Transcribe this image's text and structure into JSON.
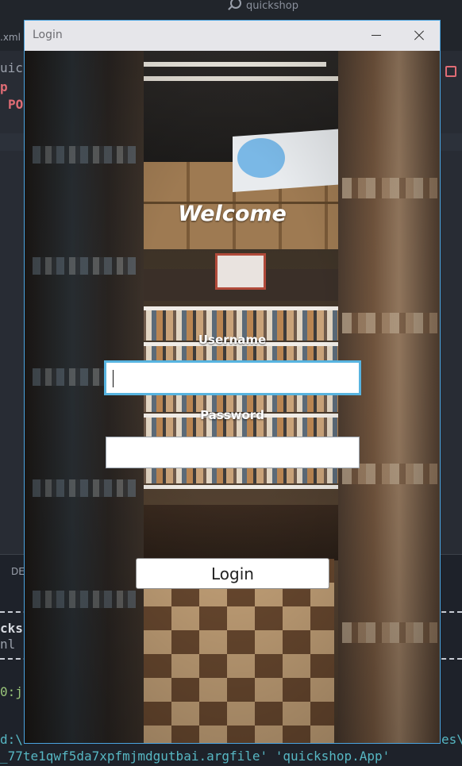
{
  "ide": {
    "search_text": "quickshop",
    "file_tab_fragment": ".xml",
    "editor_line1": "uick",
    "editor_line2": "p",
    "editor_line3": "PO",
    "panel_tab_fragment": "DE",
    "terminal_line1": "cksh",
    "terminal_line2": "nl",
    "terminal_line3": "0:j",
    "terminal_line4": "d:\\",
    "terminal_line4_right": "es\\",
    "terminal_line5": "_77te1qwf5da7xpfmjmdgutbai.argfile' 'quickshop.App'"
  },
  "window": {
    "title": "Login",
    "minimize_icon": "minimize-icon",
    "close_icon": "close-icon"
  },
  "form": {
    "welcome": "Welcome",
    "username_label": "Username",
    "username_value": "",
    "password_label": "Password",
    "password_value": "",
    "login_button": "Login"
  },
  "colors": {
    "focus_border": "#58b4e0",
    "window_border": "#4aa3df",
    "titlebar_bg": "#e6e6ea"
  }
}
